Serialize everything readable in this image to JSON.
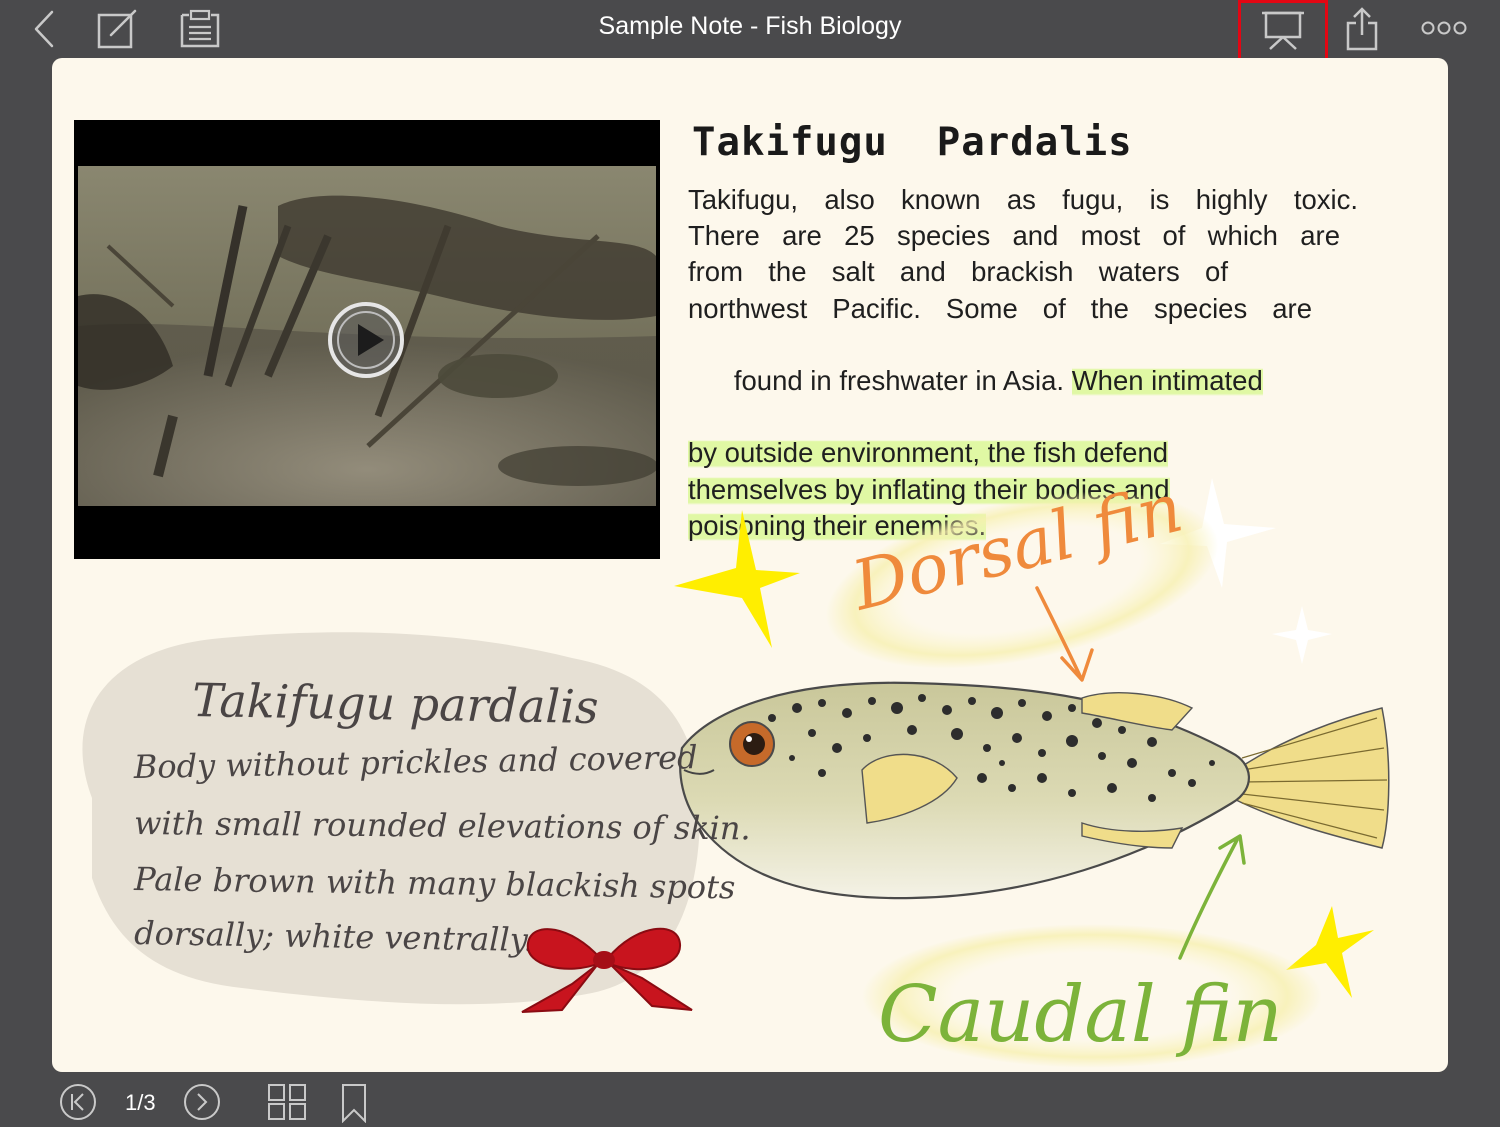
{
  "toolbar": {
    "title": "Sample Note - Fish Biology",
    "back_icon": "chevron-left-icon",
    "edit_icon": "compose-icon",
    "notes_icon": "document-icon",
    "presentation_icon": "presentation-icon",
    "share_icon": "share-icon",
    "more_icon": "more-icon",
    "highlight_color": "#e30613"
  },
  "note": {
    "heading": "Takifugu  Pardalis",
    "body_lines": [
      "Takifugu, also known as fugu, is highly toxic.",
      "There are 25 species and most of which are",
      "from the salt and brackish waters of",
      "northwest Pacific. Some of the species are",
      "found in freshwater in Asia."
    ],
    "highlight_inline": "When intimated",
    "highlight_lines": [
      "by outside environment, the fish defend",
      "themselves by inflating their bodies and",
      "poisoning their enemies."
    ],
    "highlight_color": "#d6f88c"
  },
  "annotations": {
    "dorsal_fin": "Dorsal fin",
    "caudal_fin": "Caudal fin",
    "bubble_title": "Takifugu pardalis",
    "bubble_lines": [
      "Body without prickles and covered",
      "with small rounded elevations of skin.",
      "Pale brown with many blackish spots",
      "dorsally; white ventrally."
    ]
  },
  "video": {
    "play_icon": "play-icon"
  },
  "bottombar": {
    "page_indicator": "1/3",
    "first_icon": "first-page-icon",
    "next_icon": "next-page-icon",
    "grid_icon": "grid-icon",
    "bookmark_icon": "bookmark-icon"
  }
}
